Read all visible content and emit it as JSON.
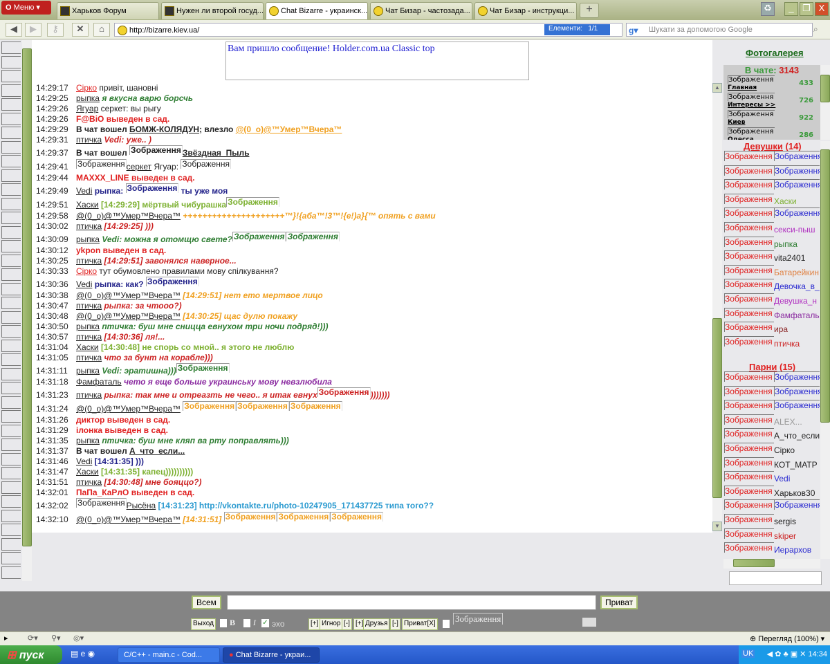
{
  "browser": {
    "menu_label": "Меню",
    "tabs": [
      {
        "label": "Харьков Форум",
        "icon": "page-icon"
      },
      {
        "label": "Нужен ли второй госуд...",
        "icon": "page-icon"
      },
      {
        "label": "Chat Bizarre - украинск...",
        "icon": "smiley-sunglasses-icon",
        "active": true
      },
      {
        "label": "Чат Бизар - частозада...",
        "icon": "smiley-sunglasses-icon"
      },
      {
        "label": "Чат Бизар - инструкци...",
        "icon": "smiley-sunglasses-icon"
      }
    ],
    "new_tab": "+",
    "url": "http://bizarre.kiev.ua/",
    "elements_label": "Елементи:",
    "elements_count": "1/1",
    "search_placeholder": "Шукати за допомогою Google"
  },
  "notice": "Вам пришло сообщение! Holder.com.ua Classic top",
  "colors": {
    "event": "#e02020",
    "ptichka": "#cc2222",
    "rypka": "#2e7d32",
    "umer": "#f0a020",
    "vedi": "#22228a",
    "haski": "#7cb030",
    "famfatal": "#8a2aa0",
    "rysena": "#2a9ad0",
    "black": "#222222"
  },
  "messages": [
    {
      "time": "14:29:17",
      "parts": [
        {
          "k": "nick",
          "t": "Сірко",
          "c": "#e02020"
        },
        {
          "k": "msg",
          "t": " привіт, шановні"
        }
      ]
    },
    {
      "time": "14:29:25",
      "parts": [
        {
          "k": "nick",
          "t": "рыпка"
        },
        {
          "k": "msg",
          "t": " я вкусна варю борсчь",
          "c": "#2e7d32",
          "s": "bi"
        }
      ]
    },
    {
      "time": "14:29:26",
      "parts": [
        {
          "k": "nick",
          "t": "Ягуар"
        },
        {
          "k": "msg",
          "t": " серкет: вы рыгу"
        }
      ]
    },
    {
      "time": "14:29:26",
      "parts": [
        {
          "k": "msg",
          "t": "F@BiO выведен в сад.",
          "c": "#e02020",
          "s": "b"
        }
      ]
    },
    {
      "time": "14:29:29",
      "parts": [
        {
          "k": "msg",
          "t": "В чат вошел ",
          "s": "b"
        },
        {
          "k": "nick",
          "t": "БОМЖ-КОЛЯДУН",
          "s": "b"
        },
        {
          "k": "msg",
          "t": "; влезло ",
          "s": "b"
        },
        {
          "k": "nick",
          "t": "@(0_o)@™Умер™Вчера™",
          "c": "#f0a020",
          "s": "b"
        }
      ]
    },
    {
      "time": "14:29:31",
      "parts": [
        {
          "k": "nick",
          "t": "птичка"
        },
        {
          "k": "msg",
          "t": " Vedi: уже.. )",
          "c": "#cc2222",
          "s": "bi"
        }
      ]
    },
    {
      "time": "14:29:37",
      "tall": true,
      "parts": [
        {
          "k": "msg",
          "t": "В чат вошел ",
          "s": "b"
        },
        {
          "k": "img",
          "t": "Зображення"
        },
        {
          "k": "nick",
          "t": "Звёздная_Пыль",
          "s": "b"
        }
      ]
    },
    {
      "time": "14:29:41",
      "tall": true,
      "parts": [
        {
          "k": "img",
          "t": "Зображення",
          "s": "n"
        },
        {
          "k": "nick",
          "t": "серкет"
        },
        {
          "k": "msg",
          "t": " Ягуар: "
        },
        {
          "k": "img",
          "t": "Зображення",
          "s": "n"
        }
      ]
    },
    {
      "time": "14:29:44",
      "parts": [
        {
          "k": "msg",
          "t": "MAXXX_LINE выведен в сад.",
          "c": "#e02020",
          "s": "b"
        }
      ]
    },
    {
      "time": "14:29:49",
      "tall": true,
      "parts": [
        {
          "k": "nick",
          "t": "Vedi"
        },
        {
          "k": "msg",
          "t": " рыпка: ",
          "c": "#22228a",
          "s": "b"
        },
        {
          "k": "img",
          "t": "Зображення",
          "c": "#22228a"
        },
        {
          "k": "msg",
          "t": " ты уже моя",
          "c": "#22228a",
          "s": "b"
        }
      ]
    },
    {
      "time": "14:29:51",
      "tall": true,
      "parts": [
        {
          "k": "nick",
          "t": "Хаски"
        },
        {
          "k": "msg",
          "t": " [14:29:29] мёртвый чибурашка",
          "c": "#7cb030",
          "s": "b"
        },
        {
          "k": "img",
          "t": "Зображення",
          "c": "#7cb030"
        }
      ]
    },
    {
      "time": "14:29:58",
      "parts": [
        {
          "k": "nick",
          "t": "@(0_o)@™Умер™Вчера™"
        },
        {
          "k": "msg",
          "t": " +++++++++++++++++++++™}!{аба™!3™!{e!)a}{™ опять с вами",
          "c": "#f0a020",
          "s": "bi"
        }
      ]
    },
    {
      "time": "14:30:02",
      "parts": [
        {
          "k": "nick",
          "t": "птичка"
        },
        {
          "k": "msg",
          "t": " [14:29:25] )))",
          "c": "#cc2222",
          "s": "bi"
        }
      ]
    },
    {
      "time": "14:30:09",
      "tall": true,
      "parts": [
        {
          "k": "nick",
          "t": "рыпка"
        },
        {
          "k": "msg",
          "t": " Vedi: можна я отомщю свете?",
          "c": "#2e7d32",
          "s": "bi"
        },
        {
          "k": "img",
          "t": "Зображення",
          "c": "#2e7d32",
          "s": "bi"
        },
        {
          "k": "img",
          "t": "Зображення",
          "c": "#2e7d32",
          "s": "bi"
        }
      ]
    },
    {
      "time": "14:30:12",
      "parts": [
        {
          "k": "msg",
          "t": "ykpon выведен в сад.",
          "c": "#e02020",
          "s": "b"
        }
      ]
    },
    {
      "time": "14:30:25",
      "parts": [
        {
          "k": "nick",
          "t": "птичка"
        },
        {
          "k": "msg",
          "t": " [14:29:51] завонялся наверное...",
          "c": "#cc2222",
          "s": "bi"
        }
      ]
    },
    {
      "time": "14:30:33",
      "parts": [
        {
          "k": "nick",
          "t": "Сірко",
          "c": "#e02020"
        },
        {
          "k": "msg",
          "t": " тут обумовлено правилами мову спілкування?"
        }
      ]
    },
    {
      "time": "14:30:36",
      "tall": true,
      "parts": [
        {
          "k": "nick",
          "t": "Vedi"
        },
        {
          "k": "msg",
          "t": " рыпка: как? ",
          "c": "#22228a",
          "s": "b"
        },
        {
          "k": "img",
          "t": "Зображення",
          "c": "#22228a"
        }
      ]
    },
    {
      "time": "14:30:38",
      "parts": [
        {
          "k": "nick",
          "t": "@(0_o)@™Умер™Вчера™"
        },
        {
          "k": "msg",
          "t": " [14:29:51] нет ето мертвое лицо",
          "c": "#f0a020",
          "s": "bi"
        }
      ]
    },
    {
      "time": "14:30:47",
      "parts": [
        {
          "k": "nick",
          "t": "птичка"
        },
        {
          "k": "msg",
          "t": " рыпка: за чтооо?)",
          "c": "#cc2222",
          "s": "bi"
        }
      ]
    },
    {
      "time": "14:30:48",
      "parts": [
        {
          "k": "nick",
          "t": "@(0_o)@™Умер™Вчера™"
        },
        {
          "k": "msg",
          "t": " [14:30:25] щас дулю покажу",
          "c": "#f0a020",
          "s": "bi"
        }
      ]
    },
    {
      "time": "14:30:50",
      "parts": [
        {
          "k": "nick",
          "t": "рыпка"
        },
        {
          "k": "msg",
          "t": " птичка: буш мне сницца евнухом три ночи подряд!)))",
          "c": "#2e7d32",
          "s": "bi"
        }
      ]
    },
    {
      "time": "14:30:57",
      "parts": [
        {
          "k": "nick",
          "t": "птичка"
        },
        {
          "k": "msg",
          "t": " [14:30:36] ля!...",
          "c": "#cc2222",
          "s": "bi"
        }
      ]
    },
    {
      "time": "14:31:04",
      "parts": [
        {
          "k": "nick",
          "t": "Хаски"
        },
        {
          "k": "msg",
          "t": " [14:30:48] не спорь со мной.. я этого не люблю",
          "c": "#7cb030",
          "s": "b"
        }
      ]
    },
    {
      "time": "14:31:05",
      "parts": [
        {
          "k": "nick",
          "t": "птичка"
        },
        {
          "k": "msg",
          "t": " что за бунт на корабле)))",
          "c": "#cc2222",
          "s": "bi"
        }
      ]
    },
    {
      "time": "14:31:11",
      "tall": true,
      "parts": [
        {
          "k": "nick",
          "t": "рыпка"
        },
        {
          "k": "msg",
          "t": " Vedi: эратишна)))",
          "c": "#2e7d32",
          "s": "bi"
        },
        {
          "k": "img",
          "t": "Зображення",
          "c": "#2e7d32"
        }
      ]
    },
    {
      "time": "14:31:18",
      "parts": [
        {
          "k": "nick",
          "t": "Фамфаталь"
        },
        {
          "k": "msg",
          "t": " чето я еще больше украинську мову невзлюбила",
          "c": "#8a2aa0",
          "s": "bi"
        }
      ]
    },
    {
      "time": "14:31:23",
      "tall": true,
      "parts": [
        {
          "k": "nick",
          "t": "птичка"
        },
        {
          "k": "msg",
          "t": " рыпка: так мне и отреазть не чего.. я итак евнух",
          "c": "#cc2222",
          "s": "bi"
        },
        {
          "k": "img",
          "t": "Зображення",
          "c": "#cc2222"
        },
        {
          "k": "msg",
          "t": ")))))))",
          "c": "#cc2222",
          "s": "bi"
        }
      ]
    },
    {
      "time": "14:31:24",
      "tall": true,
      "parts": [
        {
          "k": "nick",
          "t": "@(0_o)@™Умер™Вчера™"
        },
        {
          "k": "msg",
          "t": " "
        },
        {
          "k": "img",
          "t": "Зображення",
          "c": "#f0a020"
        },
        {
          "k": "img",
          "t": "Зображення",
          "c": "#f0a020"
        },
        {
          "k": "img",
          "t": "Зображення",
          "c": "#f0a020"
        }
      ]
    },
    {
      "time": "14:31:26",
      "parts": [
        {
          "k": "msg",
          "t": "диктор выведен в сад.",
          "c": "#e02020",
          "s": "b"
        }
      ]
    },
    {
      "time": "14:31:29",
      "parts": [
        {
          "k": "msg",
          "t": "ілонка выведен в сад.",
          "c": "#e02020",
          "s": "b"
        }
      ]
    },
    {
      "time": "14:31:35",
      "parts": [
        {
          "k": "nick",
          "t": "рыпка"
        },
        {
          "k": "msg",
          "t": " птичка: буш мне кляп ва рту поправлять)))",
          "c": "#2e7d32",
          "s": "bi"
        }
      ]
    },
    {
      "time": "14:31:37",
      "parts": [
        {
          "k": "msg",
          "t": "В чат вошел ",
          "s": "b"
        },
        {
          "k": "nick",
          "t": "А_что_если...",
          "s": "b"
        }
      ]
    },
    {
      "time": "14:31:46",
      "parts": [
        {
          "k": "nick",
          "t": "Vedi"
        },
        {
          "k": "msg",
          "t": " [14:31:35] )))",
          "c": "#22228a",
          "s": "b"
        }
      ]
    },
    {
      "time": "14:31:47",
      "parts": [
        {
          "k": "nick",
          "t": "Хаски"
        },
        {
          "k": "msg",
          "t": " [14:31:35] капец))))))))))",
          "c": "#7cb030",
          "s": "b"
        }
      ]
    },
    {
      "time": "14:31:51",
      "parts": [
        {
          "k": "nick",
          "t": "птичка"
        },
        {
          "k": "msg",
          "t": " [14:30:48] мне бояццо?)",
          "c": "#cc2222",
          "s": "bi"
        }
      ]
    },
    {
      "time": "14:32:01",
      "parts": [
        {
          "k": "msg",
          "t": "ПаПа_КаРлО выведен в сад.",
          "c": "#e02020",
          "s": "b"
        }
      ]
    },
    {
      "time": "14:32:02",
      "tall": true,
      "parts": [
        {
          "k": "img",
          "t": "Зображення",
          "s": "n"
        },
        {
          "k": "nick",
          "t": "Рысёна"
        },
        {
          "k": "msg",
          "t": " [14:31:23] http://vkontakte.ru/photo-10247905_171437725 типа того??",
          "c": "#2a9ad0",
          "s": "b"
        }
      ]
    },
    {
      "time": "14:32:10",
      "tall": true,
      "parts": [
        {
          "k": "nick",
          "t": "@(0_o)@™Умер™Вчера™"
        },
        {
          "k": "msg",
          "t": " [14:31:51] ",
          "c": "#f0a020",
          "s": "bi"
        },
        {
          "k": "img",
          "t": "Зображення",
          "c": "#f0a020"
        },
        {
          "k": "img",
          "t": "Зображення",
          "c": "#f0a020"
        },
        {
          "k": "img",
          "t": "Зображення",
          "c": "#f0a020"
        }
      ]
    }
  ],
  "sidebar": {
    "gallery": "Фотогалерея",
    "online_label": "В чате:",
    "online_count": "3143",
    "cities": [
      {
        "img": "Зображення",
        "name": "Главная",
        "count": "433"
      },
      {
        "img": "Зображення",
        "name": "Интересы >>",
        "count": "726"
      },
      {
        "img": "Зображення",
        "name": "Киев",
        "count": "922"
      },
      {
        "img": "Зображення",
        "name": "Одесса",
        "count": "286"
      }
    ],
    "girls_label": "Девушки",
    "girls_count": "(14)",
    "girls": [
      {
        "img": "Зображення",
        "right": "Зображення",
        "type": "img"
      },
      {
        "img": "Зображення",
        "right": "Зображення",
        "type": "img"
      },
      {
        "img": "Зображення",
        "right": "Зображення",
        "type": "img"
      },
      {
        "img": "Зображення",
        "right": "Хаски",
        "c": "#7cb030"
      },
      {
        "img": "Зображення",
        "right": "Зображення",
        "type": "img"
      },
      {
        "img": "Зображення",
        "right": "секси-пыш",
        "c": "#b030c0"
      },
      {
        "img": "Зображення",
        "right": "рыпка",
        "c": "#2e7d32"
      },
      {
        "img": "Зображення",
        "right": "vita2401",
        "c": "#222"
      },
      {
        "img": "Зображення",
        "right": "Батарейкин",
        "c": "#e08040"
      },
      {
        "img": "Зображення",
        "right": "Девочка_в_",
        "c": "#2a2ad0"
      },
      {
        "img": "Зображення",
        "right": "Девушка_н",
        "c": "#b030c0"
      },
      {
        "img": "Зображення",
        "right": "Фамфаталь",
        "c": "#8a2aa0"
      },
      {
        "img": "Зображення",
        "right": "ира",
        "c": "#882222"
      },
      {
        "img": "Зображення",
        "right": "птичка",
        "c": "#cc2222"
      }
    ],
    "boys_label": "Парни",
    "boys_count": "(15)",
    "boys": [
      {
        "img": "Зображення",
        "right": "Зображення",
        "type": "img"
      },
      {
        "img": "Зображення",
        "right": "Зображення",
        "type": "img"
      },
      {
        "img": "Зображення",
        "right": "Зображення",
        "type": "img"
      },
      {
        "img": "Зображення",
        "right": "ALEX...",
        "c": "#999"
      },
      {
        "img": "Зображення",
        "right": "А_что_если",
        "c": "#222"
      },
      {
        "img": "Зображення",
        "right": "Сірко",
        "c": "#222"
      },
      {
        "img": "Зображення",
        "right": "КОТ_МАТР",
        "c": "#222"
      },
      {
        "img": "Зображення",
        "right": "Vedi",
        "c": "#2a2ad0"
      },
      {
        "img": "Зображення",
        "right": "Харьков30",
        "c": "#222"
      },
      {
        "img": "Зображення",
        "right": "Зображення",
        "type": "img"
      },
      {
        "img": "Зображення",
        "right": "sergis",
        "c": "#222"
      },
      {
        "img": "Зображення",
        "right": "skiper",
        "c": "#cc2222"
      },
      {
        "img": "Зображення",
        "right": "Иерархов",
        "c": "#2a2ad0"
      }
    ]
  },
  "input": {
    "all_button": "Всем",
    "private_button": "Приват",
    "message_value": "",
    "exit": "Выход",
    "bold": "B",
    "italic": "I",
    "echo": "эхо",
    "echo_checked": true,
    "ignore": "Игнор",
    "friends": "Друзья",
    "private_x": "Приват[X]",
    "plus": "[+]",
    "minus": "[-]",
    "image": "Зображення"
  },
  "status": {
    "zoom": "Перегляд (100%)"
  },
  "taskbar": {
    "start": "пуск",
    "tasks": [
      "C/C++ - main.c - Cod...",
      "Chat Bizarre - украи..."
    ],
    "lang": "UK",
    "clock": "14:34"
  }
}
